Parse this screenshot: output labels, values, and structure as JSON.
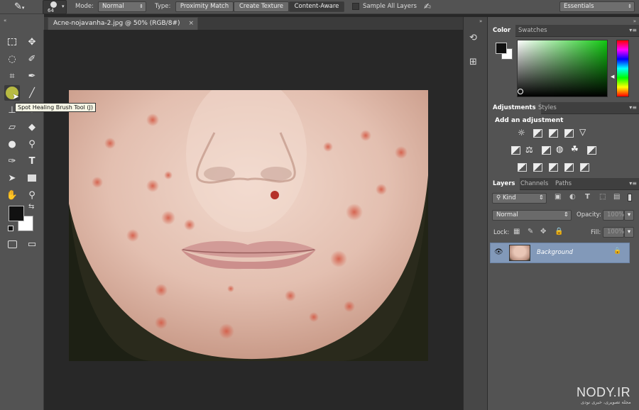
{
  "options_bar": {
    "brush_size": "64",
    "mode_label": "Mode:",
    "mode_value": "Normal",
    "type_label": "Type:",
    "type_buttons": [
      "Proximity Match",
      "Create Texture",
      "Content-Aware"
    ],
    "sample_all_layers": "Sample All Layers",
    "workspace": "Essentials"
  },
  "document": {
    "tab_title": "Acne-nojavanha-2.jpg @ 50% (RGB/8#)",
    "close_glyph": "×"
  },
  "tooltip": "Spot Healing Brush Tool (J)",
  "panels": {
    "color_tabs": [
      "Color",
      "Swatches"
    ],
    "adjust_tabs": [
      "Adjustments",
      "Styles"
    ],
    "adjust_heading": "Add an adjustment",
    "layers_tabs": [
      "Layers",
      "Channels",
      "Paths"
    ],
    "kind_label": "Kind",
    "blend_mode": "Normal",
    "opacity_label": "Opacity:",
    "opacity_value": "100%",
    "lock_label": "Lock:",
    "fill_label": "Fill:",
    "fill_value": "100%",
    "layer_name": "Background"
  },
  "watermark": {
    "brand": "NODY.IR",
    "tagline": "مجله تصویری، خبری نودی"
  },
  "colors": {
    "ui_panel": "#535353",
    "canvas_bg": "#282828",
    "layer_selected": "#8299b9",
    "foreground": "#111111",
    "background": "#ffffff"
  }
}
